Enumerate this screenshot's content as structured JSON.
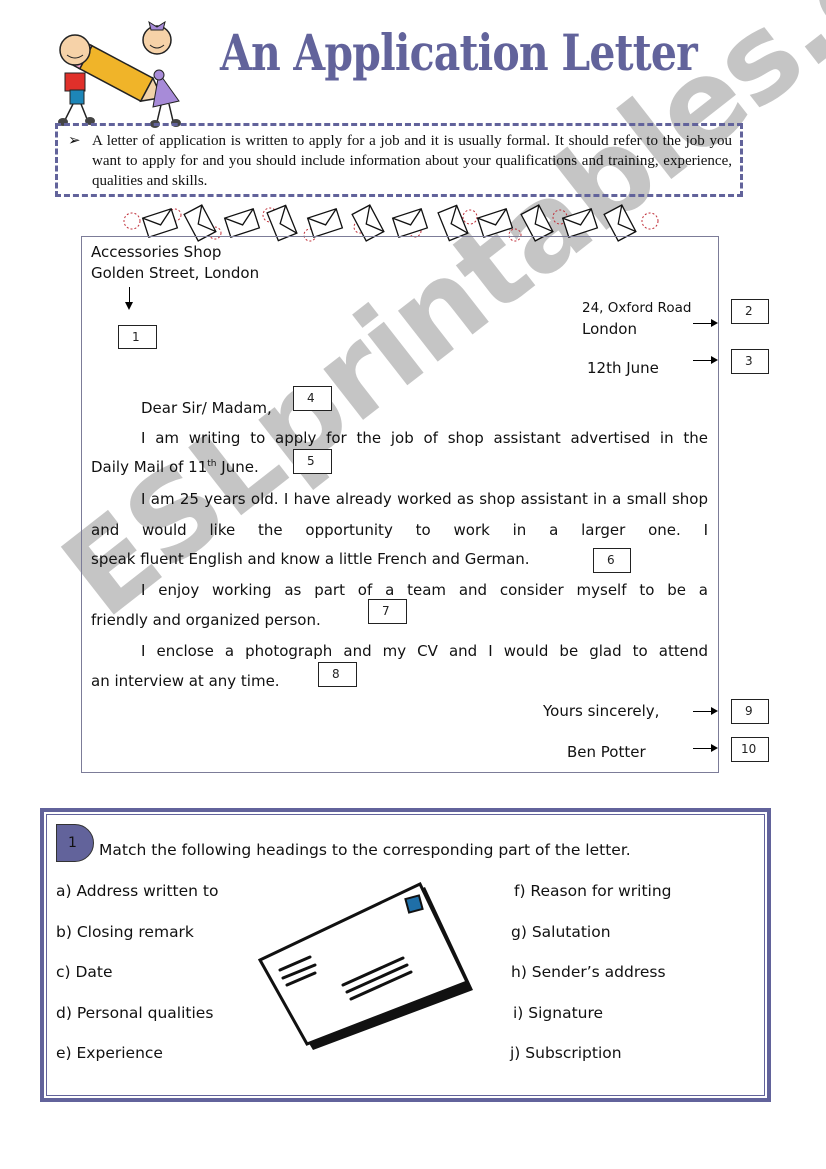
{
  "header": {
    "title": "An Application Letter",
    "illustration": "children-carrying-pencil"
  },
  "intro": {
    "bullet_icon": "arrow-bullet-icon",
    "bullet_glyph": "➢",
    "text": "A letter of application is written to apply for a job and it is usually formal. It should refer to the job you want to apply for and you should include information about your qualifications and training, experience, qualities and skills."
  },
  "letter": {
    "recipient_address": [
      "Accessories Shop",
      "Golden Street, London"
    ],
    "sender_address_line1": "24, Oxford Road",
    "sender_address_line2": "London",
    "date": "12th June",
    "salutation": "Dear Sir/ Madam,",
    "paragraph1_a": "I am writing to apply for the job of shop assistant advertised in the",
    "paragraph1_b": "Daily Mail of 11",
    "paragraph1_sup": "th",
    "paragraph1_c": " June.",
    "paragraph2": "I am 25 years old. I have already worked as shop assistant in a small shop and would like the opportunity to work in a larger one. I",
    "paragraph2_last": "speak fluent English and know a little French and German.",
    "paragraph3": "I enjoy working as part of a team and consider myself to be a",
    "paragraph3_last": "friendly and organized person.",
    "paragraph4": "I enclose a photograph and my CV and I would be glad to attend",
    "paragraph4_last": "an interview at any time.",
    "closing": "Yours sincerely,",
    "signature": "Ben Potter",
    "boxes": [
      "1",
      "2",
      "3",
      "4",
      "5",
      "6",
      "7",
      "8",
      "9",
      "10"
    ]
  },
  "exercise": {
    "number": "1",
    "instruction": "Match the following headings to the corresponding part of the letter.",
    "left_items": [
      "a) Address written to",
      "b) Closing remark",
      "c) Date",
      "d) Personal qualities",
      "e) Experience"
    ],
    "right_items": [
      "f) Reason for writing",
      "g) Salutation",
      "h) Sender’s address",
      "i) Signature",
      "j) Subscription"
    ],
    "illustration": "envelope"
  },
  "watermark": "ESLprintables.com",
  "colors": {
    "accent": "#62639b",
    "stamp": "#1f6fa8",
    "swirl": "#c0303a"
  }
}
